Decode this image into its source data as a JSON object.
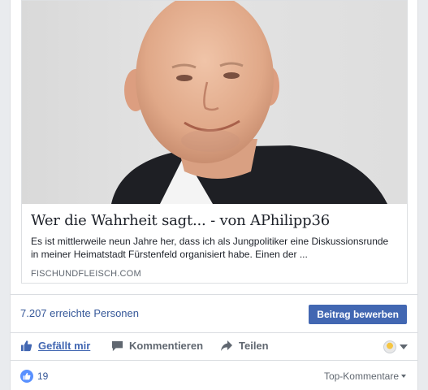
{
  "link_preview": {
    "title": "Wer die Wahrheit sagt... - von APhilipp36",
    "description": "Es ist mittlerweile neun Jahre her, dass ich als Jungpolitiker eine Diskussionsrunde in meiner Heimatstadt Fürstenfeld organisiert habe. Einen der ...",
    "domain": "FISCHUNDFLEISCH.COM",
    "image_icon": "portrait-photo-icon"
  },
  "reach": {
    "text": "7.207 erreichte Personen",
    "boost_label": "Beitrag bewerben"
  },
  "actions": {
    "like_label": "Gefällt mir",
    "comment_label": "Kommentieren",
    "share_label": "Teilen"
  },
  "summary": {
    "like_count": "19",
    "sort_label": "Top-Kommentare"
  },
  "colors": {
    "facebook_blue": "#4267b2",
    "link_blue": "#365899",
    "like_circle": "#5890ff",
    "text_gray": "#606770"
  }
}
